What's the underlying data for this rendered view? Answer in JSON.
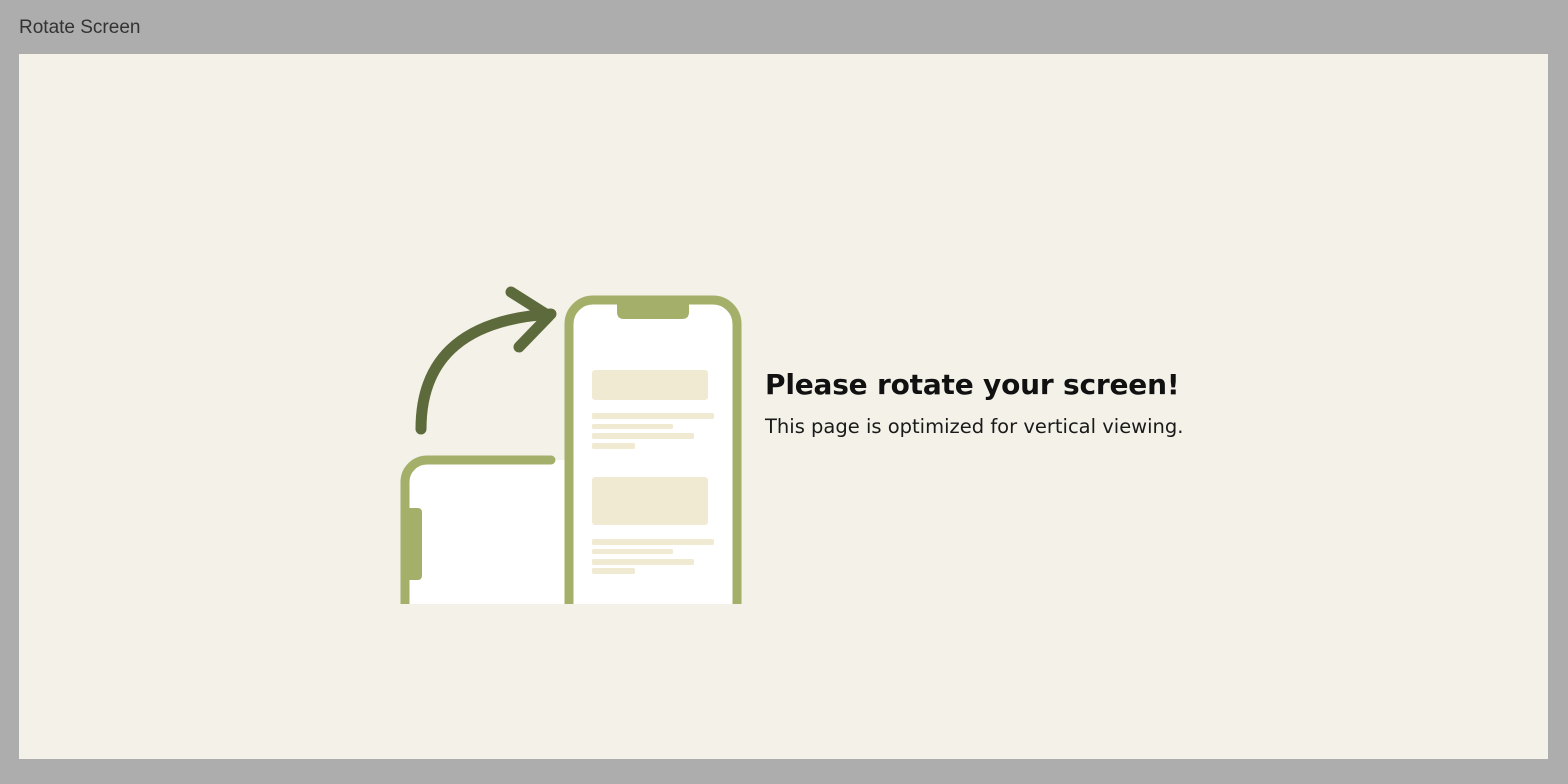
{
  "window": {
    "title": "Rotate Screen"
  },
  "illustration": {
    "icons": [
      "rotate-arrow-icon",
      "landscape-phone-icon",
      "portrait-phone-icon"
    ],
    "colors": {
      "phone_frame": "#a4b06a",
      "arrow": "#5d6a3c",
      "placeholder": "#f1ead3",
      "screen": "#ffffff"
    }
  },
  "message": {
    "headline": "Please rotate your screen!",
    "body": "This page is optimized for vertical viewing."
  },
  "colors": {
    "chrome_background": "#adadad",
    "page_background": "#f3f1e8"
  }
}
